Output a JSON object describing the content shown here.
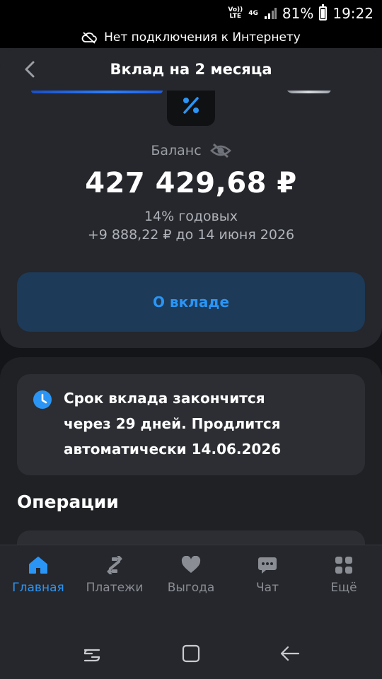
{
  "status_bar": {
    "volte": "Vo)) LTE",
    "network": "4G",
    "battery_percent": "81%",
    "battery_level": 0.81,
    "time": "19:22"
  },
  "offline_banner": {
    "icon": "cloud-off-icon",
    "text": "Нет подключения к Интернету"
  },
  "header": {
    "back_icon": "chevron-left-icon",
    "title": "Вклад на 2 месяца"
  },
  "deposit": {
    "icon": "percent-icon",
    "balance_label": "Баланс",
    "visibility_icon": "eye-off-icon",
    "balance": "427 429,68 ₽",
    "rate": "14% годовых",
    "income": "+9 888,22 ₽ до 14 июня 2026",
    "about_button": "О вкладе"
  },
  "notice": {
    "icon": "clock-icon",
    "line1": "Срок вклада закончится",
    "line2": "через 29 дней. Продлится",
    "line3": "автоматически 14.06.2026"
  },
  "operations": {
    "title": "Операции"
  },
  "tabs": [
    {
      "label": "Главная",
      "icon": "home-icon",
      "active": true
    },
    {
      "label": "Платежи",
      "icon": "transfer-icon",
      "active": false
    },
    {
      "label": "Выгода",
      "icon": "heart-icon",
      "active": false
    },
    {
      "label": "Чат",
      "icon": "chat-icon",
      "active": false
    },
    {
      "label": "Ещё",
      "icon": "grid-icon",
      "active": false
    }
  ],
  "nav": {
    "recents_icon": "recents-icon",
    "home_icon": "home-square-icon",
    "back_icon": "back-arrow-icon"
  },
  "colors": {
    "accent": "#2b95f5",
    "background": "#141518",
    "card": "#25272c",
    "button_bg": "#1d3a58"
  }
}
